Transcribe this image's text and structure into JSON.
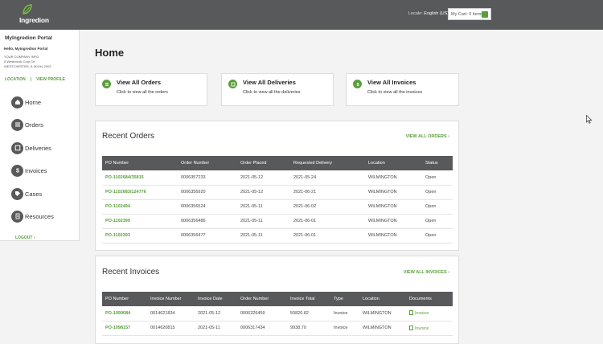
{
  "header": {
    "logo_text": "Ingredion",
    "locale_label": "Locale:",
    "locale_value": "English (US)",
    "cart_label": "My Cart: 0 items",
    "brand_color": "#5a9e3c"
  },
  "sidebar": {
    "portal_title": "MyIngredion Portal",
    "hello": "Hello, MyIngredion Portal",
    "address_lines": [
      "YOUR COMPANY INFO",
      "5 Westbrook Corp Ctr",
      "WESTCHESTER, IL 60154-2003"
    ],
    "location_link": "LOCATION",
    "profile_link": "VIEW PROFILE",
    "nav": [
      {
        "label": "Home",
        "icon": "home-icon"
      },
      {
        "label": "Orders",
        "icon": "list-icon"
      },
      {
        "label": "Deliveries",
        "icon": "box-icon"
      },
      {
        "label": "Invoices",
        "icon": "dollar-icon"
      },
      {
        "label": "Cases",
        "icon": "tag-icon"
      },
      {
        "label": "Resources",
        "icon": "document-icon"
      }
    ],
    "logout": "LOGOUT ›"
  },
  "main": {
    "title": "Home",
    "quick_cards": [
      {
        "title": "View All Orders",
        "desc": "Click to view all the orders",
        "icon": "list-icon"
      },
      {
        "title": "View All Deliveries",
        "desc": "Click to view all the deliveries",
        "icon": "box-icon"
      },
      {
        "title": "View All Invoices",
        "desc": "Click to view all the invoices",
        "icon": "dollar-icon"
      }
    ],
    "recent_orders": {
      "title": "Recent Orders",
      "link": "VIEW ALL ORDERS ›",
      "columns": [
        "PO Number",
        "Order Number",
        "Order Placed",
        "Requested Delivery",
        "Location",
        "Status"
      ],
      "rows": [
        [
          "PO-1102684/35815",
          "0006357233",
          "2021-05-12",
          "2021-05-24",
          "WILMINGTON",
          "Open"
        ],
        [
          "PO-1102683/124776",
          "0006356920",
          "2021-05-12",
          "2021-06-21",
          "WILMINGTON",
          "Open"
        ],
        [
          "PO-1102494",
          "0006356524",
          "2021-05-11",
          "2021-06-02",
          "WILMINGTON",
          "Open"
        ],
        [
          "PO-1102399",
          "0006356486",
          "2021-05-11",
          "2021-06-01",
          "WILMINGTON",
          "Open"
        ],
        [
          "PO-1102393",
          "0006356477",
          "2021-05-11",
          "2021-06-01",
          "WILMINGTON",
          "Open"
        ]
      ]
    },
    "recent_invoices": {
      "title": "Recent Invoices",
      "link": "VIEW ALL INVOICES ›",
      "columns": [
        "PO Number",
        "Invoice Number",
        "Invoice Date",
        "Order Number",
        "Invoice Total",
        "Type",
        "Location",
        "Documents"
      ],
      "rows": [
        [
          "PO-1099084",
          "0014621834",
          "2021-05-12",
          "0006326459",
          "50820.82",
          "Invoice",
          "WILMINGTON",
          "Invoice"
        ],
        [
          "PO-1098157",
          "0014620815",
          "2021-05-11",
          "0006317434",
          "9938.70",
          "Invoice",
          "WILMINGTON",
          "Invoice"
        ]
      ]
    }
  }
}
